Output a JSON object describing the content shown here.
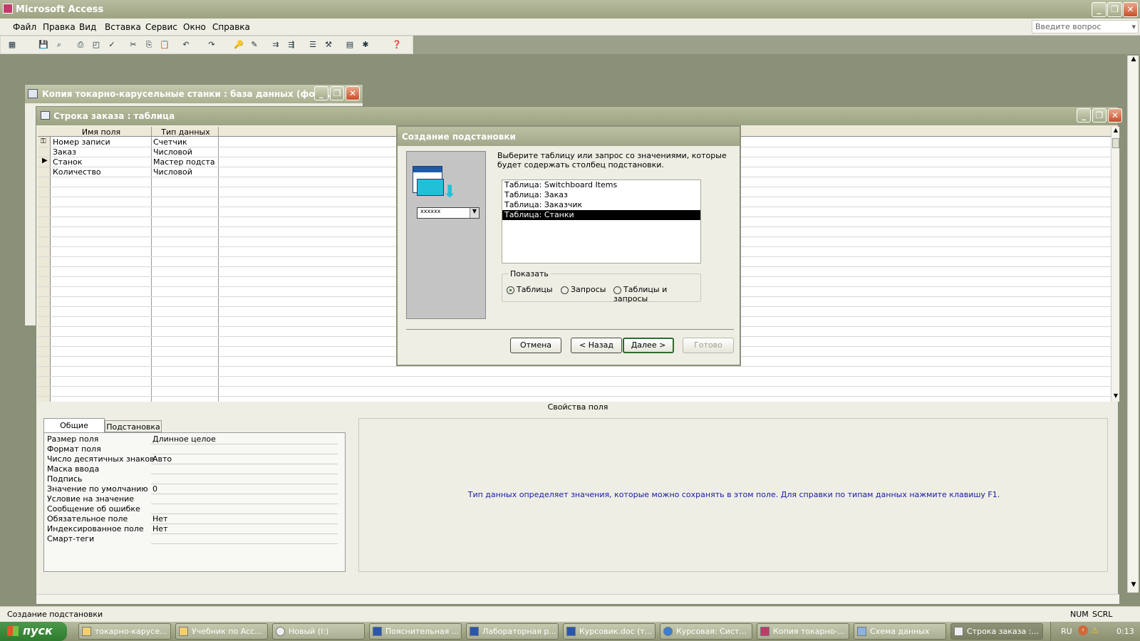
{
  "app": {
    "title": "Microsoft Access",
    "ask_placeholder": "Введите вопрос"
  },
  "menu": [
    "Файл",
    "Правка",
    "Вид",
    "Вставка",
    "Сервис",
    "Окно",
    "Справка"
  ],
  "db_window": {
    "title": "Копия токарно-карусельные станки : база данных (фор..."
  },
  "table_window": {
    "title": "Строка заказа : таблица",
    "col_field": "Имя поля",
    "col_type": "Тип данных",
    "rows": [
      {
        "field": "Номер записи",
        "type": "Счетчик"
      },
      {
        "field": "Заказ",
        "type": "Числовой"
      },
      {
        "field": "Станок",
        "type": "Мастер подста"
      },
      {
        "field": "Количество",
        "type": "Числовой"
      }
    ],
    "props_header": "Свойства поля",
    "tabs": [
      "Общие",
      "Подстановка"
    ],
    "properties": [
      {
        "name": "Размер поля",
        "value": "Длинное целое"
      },
      {
        "name": "Формат поля",
        "value": ""
      },
      {
        "name": "Число десятичных знаков",
        "value": "Авто"
      },
      {
        "name": "Маска ввода",
        "value": ""
      },
      {
        "name": "Подпись",
        "value": ""
      },
      {
        "name": "Значение по умолчанию",
        "value": "0"
      },
      {
        "name": "Условие на значение",
        "value": ""
      },
      {
        "name": "Сообщение об ошибке",
        "value": ""
      },
      {
        "name": "Обязательное поле",
        "value": "Нет"
      },
      {
        "name": "Индексированное поле",
        "value": "Нет"
      },
      {
        "name": "Смарт-теги",
        "value": ""
      }
    ],
    "help_text": "Тип данных определяет значения, которые можно сохранять в этом поле.  Для справки по типам данных нажмите клавишу F1."
  },
  "dialog": {
    "title": "Создание подстановки",
    "instruction": "Выберите таблицу или запрос со значениями, которые будет содержать столбец подстановки.",
    "preview_combo": "xxxxxx",
    "list": [
      "Таблица: Switchboard Items",
      "Таблица: Заказ",
      "Таблица: Заказчик",
      "Таблица: Станки"
    ],
    "selected_index": 3,
    "show_label": "Показать",
    "radios": [
      "Таблицы",
      "Запросы",
      "Таблицы и запросы"
    ],
    "radio_selected": 0,
    "buttons": {
      "cancel": "Отмена",
      "back": "< Назад",
      "next": "Далее >",
      "finish": "Готово"
    }
  },
  "status": {
    "text": "Создание подстановки",
    "num": "NUM",
    "scrl": "SCRL"
  },
  "taskbar": {
    "start": "пуск",
    "tasks": [
      "токарно-карусе...",
      "Учебник по Acc...",
      "Новый (I:)",
      "Пояснительная ...",
      "Лабораторная р...",
      "Курсовик.doc (т...",
      "Курсовая: Сист...",
      "Копия токарно-...",
      "Схема данных",
      "Строка заказа :..."
    ],
    "lang": "RU",
    "clock": "0:13"
  },
  "colors": {
    "accent": "#2e6e2e",
    "help_text": "#1a1aa8",
    "selection": "#000000"
  }
}
